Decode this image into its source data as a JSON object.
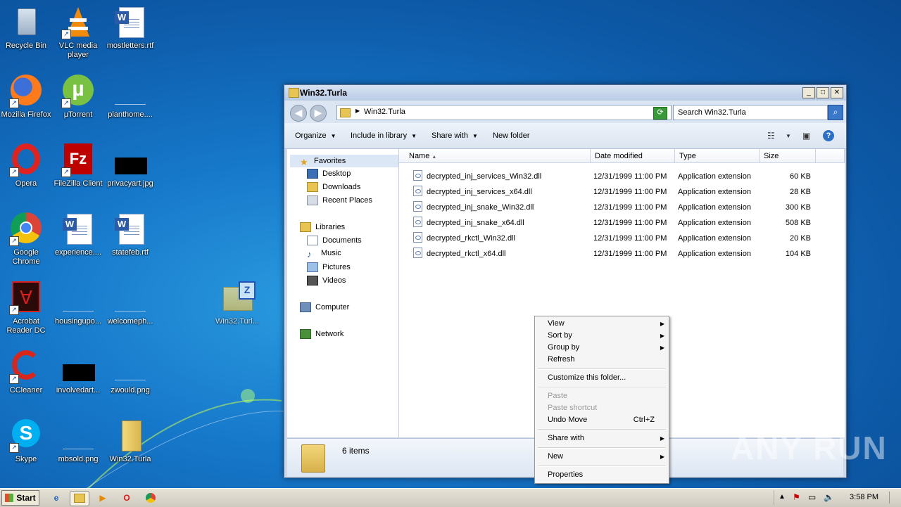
{
  "desktop": {
    "icons": [
      {
        "label": "Recycle Bin"
      },
      {
        "label": "VLC media player"
      },
      {
        "label": "mostletters.rtf"
      },
      {
        "label": "Mozilla Firefox"
      },
      {
        "label": "µTorrent"
      },
      {
        "label": "planthome...."
      },
      {
        "label": "Opera"
      },
      {
        "label": "FileZilla Client"
      },
      {
        "label": "privacyart.jpg"
      },
      {
        "label": "Google Chrome"
      },
      {
        "label": "experience...."
      },
      {
        "label": "statefeb.rtf"
      },
      {
        "label": "Acrobat Reader DC"
      },
      {
        "label": "housingupo..."
      },
      {
        "label": "welcomeph..."
      },
      {
        "label": "Win32.Turl..."
      },
      {
        "label": "CCleaner"
      },
      {
        "label": "involvedart..."
      },
      {
        "label": "zwould.png"
      },
      {
        "label": "Skype"
      },
      {
        "label": "mbsold.png"
      },
      {
        "label": "Win32.Turla"
      }
    ]
  },
  "window": {
    "title": "Win32.Turla",
    "address": "Win32.Turla",
    "search_placeholder": "Search Win32.Turla",
    "toolbar": {
      "organize": "Organize",
      "include": "Include in library",
      "share": "Share with",
      "new_folder": "New folder"
    },
    "nav": {
      "favorites": "Favorites",
      "desktop": "Desktop",
      "downloads": "Downloads",
      "recent": "Recent Places",
      "libraries": "Libraries",
      "documents": "Documents",
      "music": "Music",
      "pictures": "Pictures",
      "videos": "Videos",
      "computer": "Computer",
      "network": "Network"
    },
    "columns": {
      "name": "Name",
      "date": "Date modified",
      "type": "Type",
      "size": "Size"
    },
    "files": [
      {
        "name": "decrypted_inj_services_Win32.dll",
        "date": "12/31/1999 11:00 PM",
        "type": "Application extension",
        "size": "60 KB"
      },
      {
        "name": "decrypted_inj_services_x64.dll",
        "date": "12/31/1999 11:00 PM",
        "type": "Application extension",
        "size": "28 KB"
      },
      {
        "name": "decrypted_inj_snake_Win32.dll",
        "date": "12/31/1999 11:00 PM",
        "type": "Application extension",
        "size": "300 KB"
      },
      {
        "name": "decrypted_inj_snake_x64.dll",
        "date": "12/31/1999 11:00 PM",
        "type": "Application extension",
        "size": "508 KB"
      },
      {
        "name": "decrypted_rkctl_Win32.dll",
        "date": "12/31/1999 11:00 PM",
        "type": "Application extension",
        "size": "20 KB"
      },
      {
        "name": "decrypted_rkctl_x64.dll",
        "date": "12/31/1999 11:00 PM",
        "type": "Application extension",
        "size": "104 KB"
      }
    ],
    "status": "6 items"
  },
  "context_menu": {
    "view": "View",
    "sort_by": "Sort by",
    "group_by": "Group by",
    "refresh": "Refresh",
    "customize": "Customize this folder...",
    "paste": "Paste",
    "paste_shortcut": "Paste shortcut",
    "undo_move": "Undo Move",
    "undo_shortcut": "Ctrl+Z",
    "share_with": "Share with",
    "new": "New",
    "properties": "Properties"
  },
  "taskbar": {
    "start": "Start",
    "clock": "3:58 PM"
  },
  "watermark": "ANY RUN"
}
